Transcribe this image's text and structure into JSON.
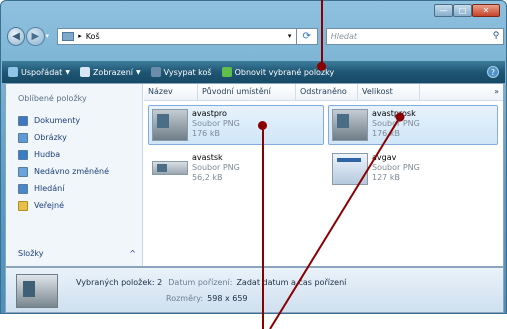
{
  "window": {
    "caption_buttons": [
      "—",
      "□",
      "✕"
    ]
  },
  "address": {
    "path_sep": "▸",
    "location": "Koš",
    "refresh_icon": "refresh-icon",
    "search_placeholder": "Hledat"
  },
  "toolbar": {
    "organize": "Uspořádat",
    "views": "Zobrazení",
    "empty_bin": "Vysypat koš",
    "restore": "Obnovit vybrané položky",
    "help": "?"
  },
  "navpane": {
    "title": "Oblíbené položky",
    "items": [
      "Dokumenty",
      "Obrázky",
      "Hudba",
      "Nedávno změněné",
      "Hledání",
      "Veřejné"
    ],
    "footer": "Složky",
    "footer_caret": "^"
  },
  "columns": [
    "Název",
    "Původní umístění",
    "Odstraněno",
    "Velikost",
    "»"
  ],
  "files": [
    {
      "name": "avastpro",
      "type": "Soubor PNG",
      "size": "176 kB",
      "selected": true
    },
    {
      "name": "avastprosk",
      "type": "Soubor PNG",
      "size": "176 kB",
      "selected": true
    },
    {
      "name": "avastsk",
      "type": "Soubor PNG",
      "size": "56,2 kB",
      "selected": false
    },
    {
      "name": "avgav",
      "type": "Soubor PNG",
      "size": "127 kB",
      "selected": false
    }
  ],
  "details": {
    "count_label": "Vybraných položek: 2",
    "date_key": "Datum pořízení:",
    "date_val": "Zadat datum a čas pořízení",
    "dims_key": "Rozměry:",
    "dims_val": "598 x 659"
  },
  "colors": {
    "toolbar": "#1f5674",
    "callout": "#8a0000",
    "selection": "#cfe6f8"
  }
}
